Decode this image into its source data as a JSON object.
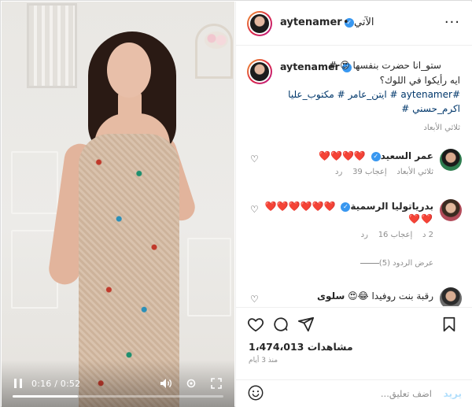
{
  "video": {
    "time": "0:16 / 0:52",
    "progress": 0.31
  },
  "header": {
    "username": "aytenamer",
    "follow_label": "الآتي",
    "dot": "•",
    "more": "···"
  },
  "caption": {
    "username": "aytenamer",
    "line1": "ستو_انا حضرت بنفسها 😍 #",
    "line2": "ايه رأيكوا في اللوك؟",
    "line3": "#aytenamer # ايتن_عامر # مكتوب_عليا",
    "line4": "اكرم_حسني #",
    "time": "ثلاثي الأبعاد"
  },
  "comments": [
    {
      "username": "عمر السعيد",
      "text": "❤️❤️❤️❤️",
      "likes": "إعجاب 39",
      "time": "ثلاثي الأبعاد",
      "reply": "رد"
    },
    {
      "username": "بدرياتوليا الرسمية",
      "text": "❤️❤️❤️❤️❤️❤️",
      "text2": "❤️❤️",
      "likes": "إعجاب 16",
      "time": "2 د",
      "reply": "رد",
      "view_replies": "عرض الردود (5)"
    },
    {
      "username": "سلوى",
      "text": "رقبة بنت روفيدا 😂😍",
      "likes": "",
      "time": "",
      "reply": ""
    }
  ],
  "stats": {
    "views": "1،474،013 مشاهدات",
    "since": "منذ 3 أيام"
  },
  "add_comment": {
    "placeholder": "اضف تعليق...",
    "post_label": "يريد"
  },
  "colors": {
    "accent": "#3897f0",
    "heart": "#ed4956",
    "muted": "#8e8e8e",
    "post_disabled": "#b2dffc"
  },
  "icons": [
    "play-icon",
    "volume-icon",
    "settings-icon",
    "fullscreen-icon",
    "heart-icon",
    "comment-icon",
    "share-icon",
    "save-icon",
    "emoji-icon",
    "more-icon",
    "verified-icon"
  ]
}
